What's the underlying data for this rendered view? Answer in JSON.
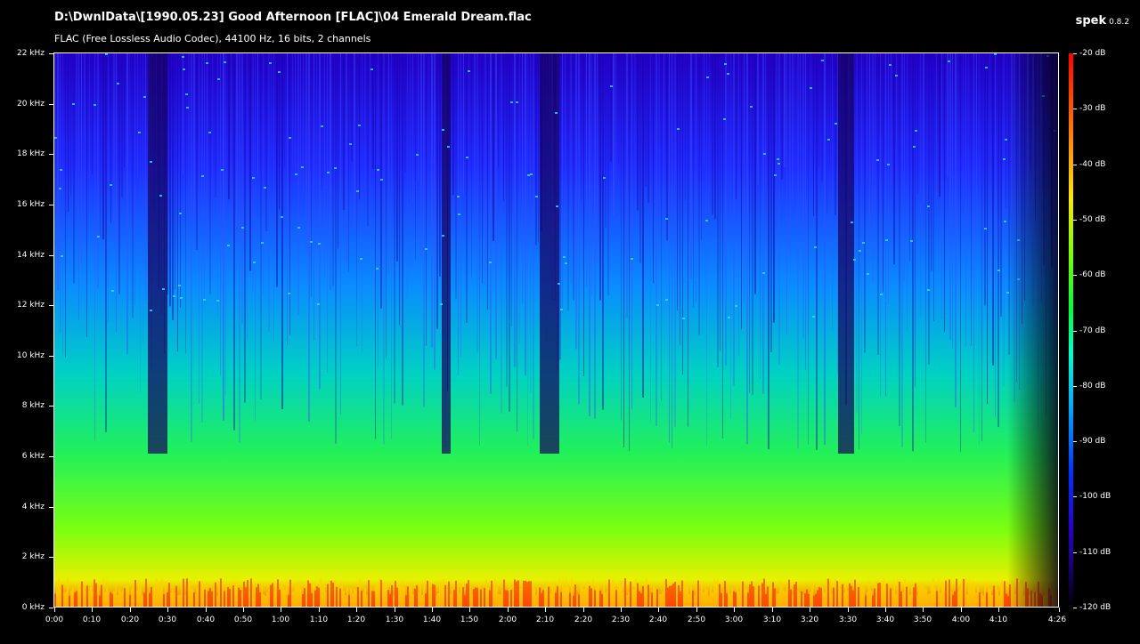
{
  "header": {
    "file_path": "D:\\DwnlData\\[1990.05.23] Good Afternoon [FLAC]\\04 Emerald Dream.flac",
    "codec_info": "FLAC (Free Lossless Audio Codec), 44100 Hz, 16 bits, 2 channels",
    "app_name": "spek",
    "app_version": "0.8.2"
  },
  "frequency_axis": {
    "labels": [
      "22 kHz",
      "20 kHz",
      "18 kHz",
      "16 kHz",
      "14 kHz",
      "12 kHz",
      "10 kHz",
      "8 kHz",
      "6 kHz",
      "4 kHz",
      "2 kHz",
      "0 kHz"
    ],
    "max_khz": 22
  },
  "time_axis": {
    "labels": [
      "0:00",
      "0:10",
      "0:20",
      "0:30",
      "0:40",
      "0:50",
      "1:00",
      "1:10",
      "1:20",
      "1:30",
      "1:40",
      "1:50",
      "2:00",
      "2:10",
      "2:20",
      "2:30",
      "2:40",
      "2:50",
      "3:00",
      "3:10",
      "3:20",
      "3:30",
      "3:40",
      "3:50",
      "4:00",
      "4:10",
      "4:26"
    ],
    "duration_seconds": 266
  },
  "colorbar": {
    "labels": [
      "-20 dB",
      "-30 dB",
      "-40 dB",
      "-50 dB",
      "-60 dB",
      "-70 dB",
      "-80 dB",
      "-90 dB",
      "-100 dB",
      "-110 dB",
      "-120 dB"
    ],
    "colors": [
      "#ff0000",
      "#ff6a00",
      "#ffe600",
      "#7cff00",
      "#00ff3a",
      "#00ffd0",
      "#00a8ff",
      "#0030ff",
      "#2a00c8",
      "#160060",
      "#000000"
    ]
  }
}
